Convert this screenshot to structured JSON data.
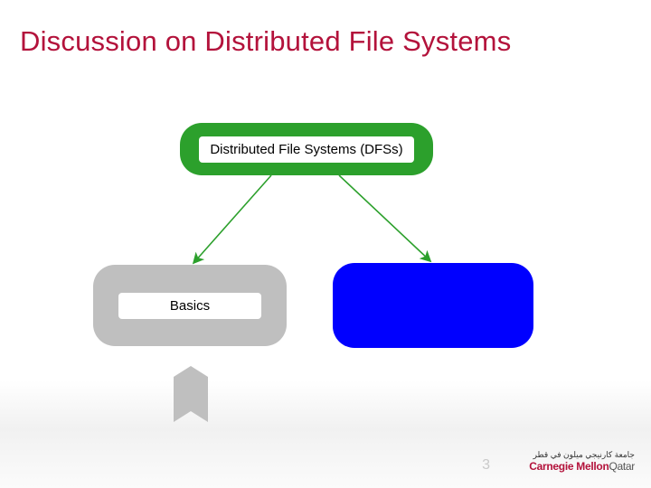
{
  "title": "Discussion on Distributed File Systems",
  "diagram": {
    "root": {
      "label": "Distributed File Systems (DFSs)",
      "fill": "#2ca02c"
    },
    "left": {
      "label": "Basics",
      "fill": "#bfbfbf"
    },
    "right": {
      "label": "",
      "fill": "#0000ff"
    },
    "arrow_color": "#2ca02c"
  },
  "ribbon": {
    "fill": "#bfbfbf"
  },
  "page_number": "3",
  "footer": {
    "arabic": "جامعة كارنيجي ميلون في قطر",
    "brand": "Carnegie Mellon",
    "suffix": "Qatar"
  }
}
